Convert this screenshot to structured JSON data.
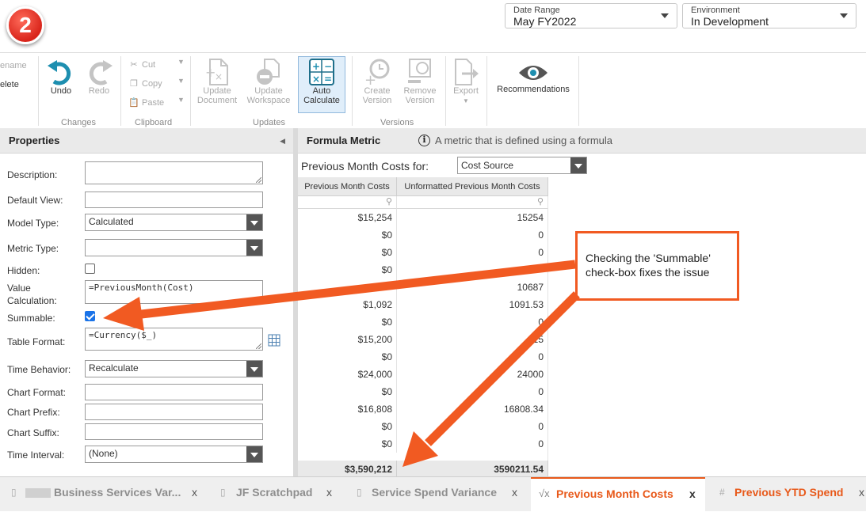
{
  "step_badge": "2",
  "date_range": {
    "label": "Date Range",
    "value": "May FY2022"
  },
  "environment": {
    "label": "Environment",
    "value": "In Development"
  },
  "ribbon": {
    "partial": {
      "rename": "ename",
      "delete": "elete"
    },
    "undo": "Undo",
    "redo": "Redo",
    "cut": "Cut",
    "copy": "Copy",
    "paste": "Paste",
    "update_document": [
      "Update",
      "Document"
    ],
    "update_workspace": [
      "Update",
      "Workspace"
    ],
    "auto_calculate": [
      "Auto",
      "Calculate"
    ],
    "create_version": [
      "Create",
      "Version"
    ],
    "remove_version": [
      "Remove",
      "Version"
    ],
    "export": "Export",
    "recommendations": "Recommendations",
    "groups": {
      "changes": "Changes",
      "clipboard": "Clipboard",
      "updates": "Updates",
      "versions": "Versions"
    }
  },
  "properties": {
    "title": "Properties",
    "fields": {
      "description": {
        "label": "Description:",
        "value": ""
      },
      "default_view": {
        "label": "Default View:",
        "value": ""
      },
      "model_type": {
        "label": "Model Type:",
        "value": "Calculated"
      },
      "metric_type": {
        "label": "Metric Type:",
        "value": ""
      },
      "hidden": {
        "label": "Hidden:",
        "checked": false
      },
      "value_calculation": {
        "label": "Value Calculation:",
        "value": "=PreviousMonth(Cost)"
      },
      "summable": {
        "label": "Summable:",
        "checked": true
      },
      "table_format": {
        "label": "Table Format:",
        "value": "=Currency($_)"
      },
      "time_behavior": {
        "label": "Time Behavior:",
        "value": "Recalculate"
      },
      "chart_format": {
        "label": "Chart Format:",
        "value": ""
      },
      "chart_prefix": {
        "label": "Chart Prefix:",
        "value": ""
      },
      "chart_suffix": {
        "label": "Chart Suffix:",
        "value": ""
      },
      "time_interval": {
        "label": "Time Interval:",
        "value": "(None)"
      }
    }
  },
  "main": {
    "title": "Formula Metric",
    "info": "A metric that is defined using a formula",
    "for_label": "Previous Month Costs for:",
    "for_value": "Cost Source",
    "columns": [
      "Previous Month Costs",
      "Unformatted Previous Month Costs"
    ],
    "rows": [
      [
        "$15,254",
        "15254"
      ],
      [
        "$0",
        "0"
      ],
      [
        "$0",
        "0"
      ],
      [
        "$0",
        ""
      ],
      [
        "",
        "10687"
      ],
      [
        "$1,092",
        "1091.53"
      ],
      [
        "$0",
        "0"
      ],
      [
        "$15,200",
        "15"
      ],
      [
        "$0",
        "0"
      ],
      [
        "$24,000",
        "24000"
      ],
      [
        "$0",
        "0"
      ],
      [
        "$16,808",
        "16808.34"
      ],
      [
        "$0",
        "0"
      ],
      [
        "$0",
        "0"
      ]
    ],
    "totals": [
      "$3,590,212",
      "3590211.54"
    ]
  },
  "callout": "Checking the 'Summable' check-box fixes the issue",
  "tabs": [
    {
      "label": "Business Services Var...",
      "close": "x"
    },
    {
      "label": "JF Scratchpad",
      "close": "x"
    },
    {
      "label": "Service Spend Variance",
      "close": "x"
    },
    {
      "label": "Previous Month Costs",
      "close": "x"
    },
    {
      "label": "Previous YTD Spend",
      "close": "x"
    }
  ],
  "colors": {
    "accent": "#e8591a",
    "annotation": "#f15a22",
    "teal": "#1e8fb0",
    "checkbox": "#1a73e8"
  }
}
